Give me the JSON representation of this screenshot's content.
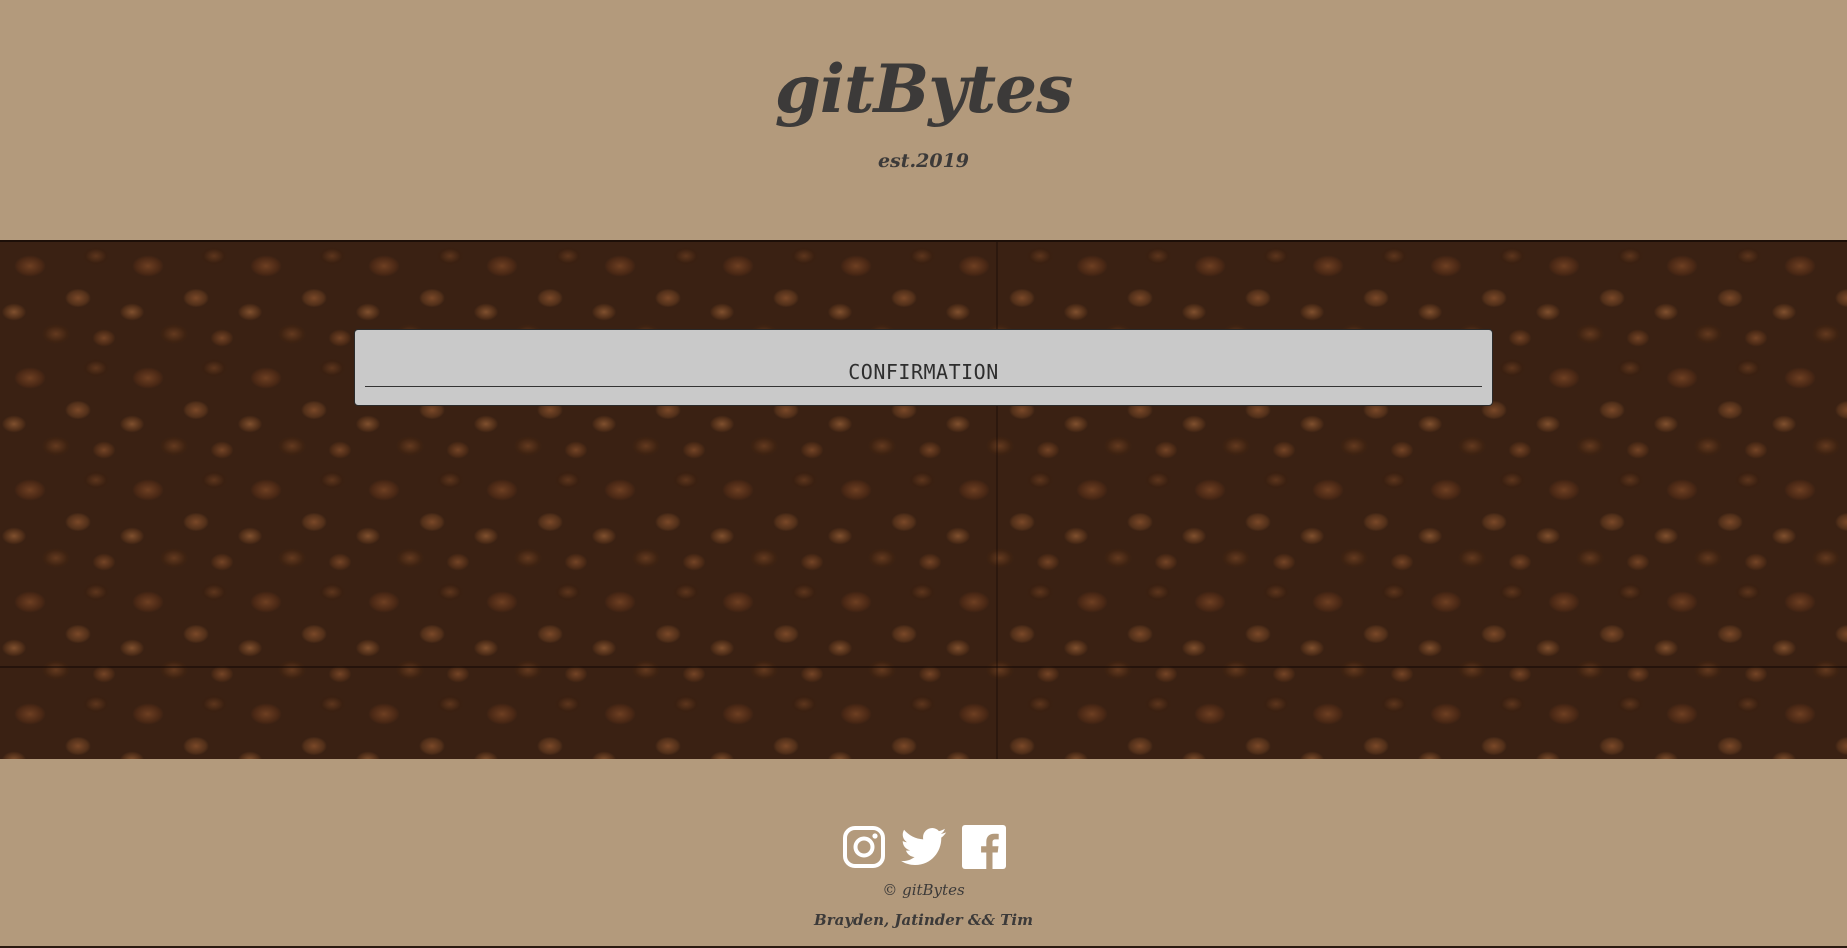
{
  "header": {
    "logo_text": "gitBytes",
    "tagline": "est.2019"
  },
  "main": {
    "confirmation_title": "CONFIRMATION"
  },
  "footer": {
    "social_icons": [
      "instagram-icon",
      "twitter-icon",
      "facebook-icon"
    ],
    "copyright": "© gitBytes",
    "authors": "Brayden, Jatinder && Tim"
  },
  "colors": {
    "page_background": "#b39a7c",
    "text_dark": "#3c3a39",
    "panel_background": "#c9c9c9",
    "icon_white": "#ffffff"
  }
}
